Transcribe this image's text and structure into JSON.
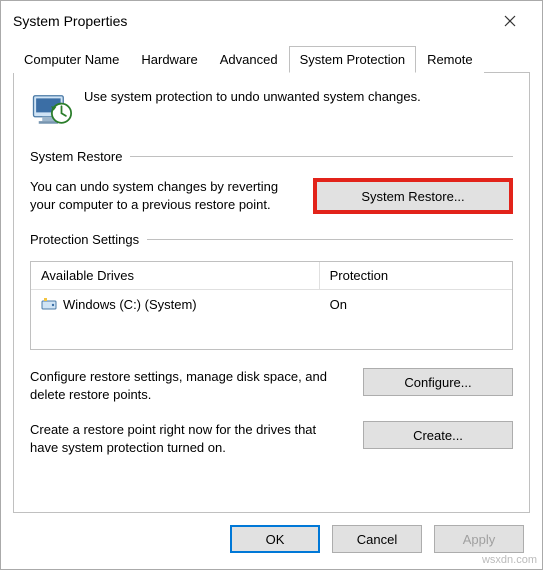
{
  "window": {
    "title": "System Properties"
  },
  "tabs": {
    "items": [
      {
        "label": "Computer Name"
      },
      {
        "label": "Hardware"
      },
      {
        "label": "Advanced"
      },
      {
        "label": "System Protection"
      },
      {
        "label": "Remote"
      }
    ],
    "active_index": 3
  },
  "intro": {
    "text": "Use system protection to undo unwanted system changes."
  },
  "restore": {
    "group_label": "System Restore",
    "description": "You can undo system changes by reverting your computer to a previous restore point.",
    "button": "System Restore..."
  },
  "protection": {
    "group_label": "Protection Settings",
    "columns": {
      "drives": "Available Drives",
      "status": "Protection"
    },
    "rows": [
      {
        "drive": "Windows (C:) (System)",
        "status": "On",
        "icon": "drive-icon"
      }
    ],
    "configure_text": "Configure restore settings, manage disk space, and delete restore points.",
    "configure_button": "Configure...",
    "create_text": "Create a restore point right now for the drives that have system protection turned on.",
    "create_button": "Create..."
  },
  "actions": {
    "ok": "OK",
    "cancel": "Cancel",
    "apply": "Apply"
  },
  "watermark": "wsxdn.com"
}
